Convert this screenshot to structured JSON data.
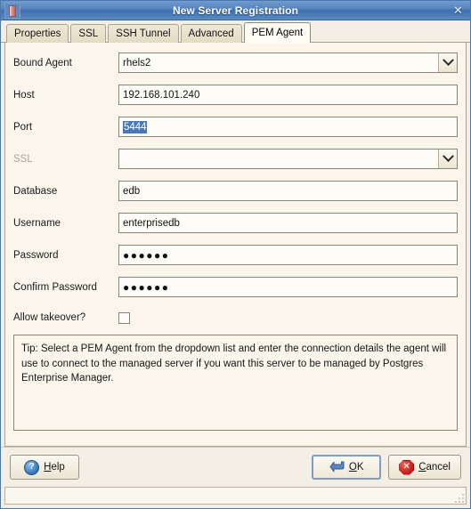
{
  "window": {
    "title": "New Server Registration",
    "icon": "database-icon",
    "close_label": "✕"
  },
  "tabs": [
    {
      "label": "Properties",
      "active": false
    },
    {
      "label": "SSL",
      "active": false
    },
    {
      "label": "SSH Tunnel",
      "active": false
    },
    {
      "label": "Advanced",
      "active": false
    },
    {
      "label": "PEM Agent",
      "active": true
    }
  ],
  "form": {
    "bound_agent": {
      "label": "Bound Agent",
      "value": "rhels2",
      "type": "combobox"
    },
    "host": {
      "label": "Host",
      "value": "192.168.101.240",
      "type": "text"
    },
    "port": {
      "label": "Port",
      "value": "5444",
      "type": "text",
      "selected": true
    },
    "ssl": {
      "label": "SSL",
      "value": "",
      "type": "combobox",
      "disabled": true
    },
    "database": {
      "label": "Database",
      "value": "edb",
      "type": "text"
    },
    "username": {
      "label": "Username",
      "value": "enterprisedb",
      "type": "text"
    },
    "password": {
      "label": "Password",
      "value": "●●●●●●",
      "type": "password"
    },
    "confirm_password": {
      "label": "Confirm Password",
      "value": "●●●●●●",
      "type": "password"
    },
    "allow_takeover": {
      "label": "Allow takeover?",
      "checked": false,
      "type": "checkbox"
    }
  },
  "tip": {
    "text": "Tip: Select a PEM Agent from the dropdown list and enter the connection details the agent will use to connect to the managed server if you want this server to be managed by Postgres Enterprise Manager."
  },
  "buttons": {
    "help": {
      "label": "Help",
      "accel": "H",
      "icon": "help-icon"
    },
    "ok": {
      "label": "OK",
      "accel": "O",
      "icon": "enter-arrow-icon",
      "default": true
    },
    "cancel": {
      "label": "Cancel",
      "accel": "C",
      "icon": "cancel-icon"
    }
  },
  "statusbar": {
    "text": ""
  },
  "colors": {
    "titlebar": "#4f7fba",
    "panel_bg": "#faf6ec",
    "dialog_bg": "#f3efe4",
    "selection": "#4a77b5",
    "accent_border": "#7e9cc4"
  }
}
